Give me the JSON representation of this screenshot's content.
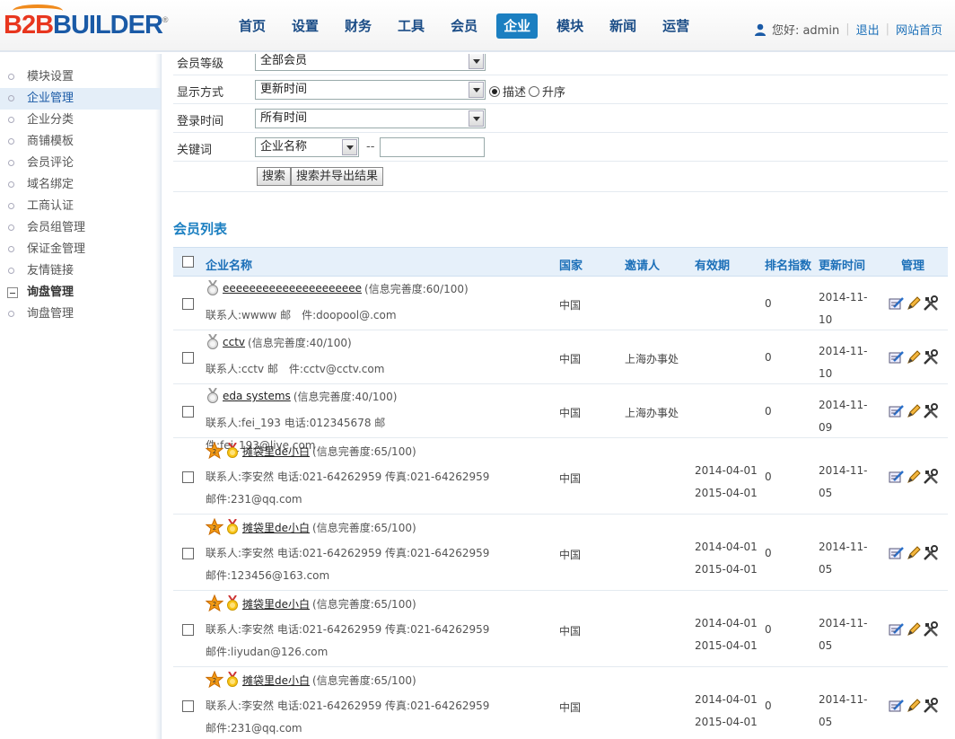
{
  "logo": {
    "b2b": "B2B",
    "builder": "BUILDER",
    "reg": "®"
  },
  "nav": {
    "items": [
      {
        "label": "首页",
        "active": false
      },
      {
        "label": "设置",
        "active": false
      },
      {
        "label": "财务",
        "active": false
      },
      {
        "label": "工具",
        "active": false
      },
      {
        "label": "会员",
        "active": false
      },
      {
        "label": "企业",
        "active": true
      },
      {
        "label": "模块",
        "active": false
      },
      {
        "label": "新闻",
        "active": false
      },
      {
        "label": "运营",
        "active": false
      }
    ]
  },
  "user": {
    "greeting": "您好: admin",
    "logout": "退出",
    "site_home": "网站首页"
  },
  "sidebar": {
    "items": [
      {
        "label": "模块设置"
      },
      {
        "label": "企业管理"
      },
      {
        "label": "企业分类"
      },
      {
        "label": "商铺模板"
      },
      {
        "label": "会员评论"
      },
      {
        "label": "域名绑定"
      },
      {
        "label": "工商认证"
      },
      {
        "label": "会员组管理"
      },
      {
        "label": "保证金管理"
      },
      {
        "label": "友情链接"
      }
    ],
    "group": {
      "label": "询盘管理"
    },
    "group_items": [
      {
        "label": "询盘管理"
      }
    ]
  },
  "filters": {
    "member_level_label": "会员等级",
    "member_level_value": "全部会员",
    "display_label": "显示方式",
    "display_value": "更新时间",
    "order_desc": "描述",
    "order_asc": "升序",
    "login_label": "登录时间",
    "login_value": "所有时间",
    "keyword_label": "关键词",
    "keyword_field": "企业名称",
    "range_sep": "--",
    "search_button": "搜索",
    "export_button": "搜索并导出结果"
  },
  "list": {
    "title": "会员列表",
    "columns": {
      "name": "企业名称",
      "country": "国家",
      "inviter": "邀请人",
      "validity": "有效期",
      "rank": "排名指数",
      "updated": "更新时间",
      "manage": "管理"
    },
    "rows": [
      {
        "name": "eeeeeeeeeeeeeeeeeeeee",
        "completeness": "(信息完善度:60/100)",
        "contact": "联系人:wwww 邮　件:doopool@.com",
        "country": "中国",
        "inviter": "",
        "valid_from": "",
        "valid_to": "",
        "rank": "0",
        "updated": "2014-11-10",
        "vip": false
      },
      {
        "name": "cctv",
        "completeness": "(信息完善度:40/100)",
        "contact": "联系人:cctv 邮　件:cctv@cctv.com",
        "country": "中国",
        "inviter": "上海办事处",
        "valid_from": "",
        "valid_to": "",
        "rank": "0",
        "updated": "2014-11-10",
        "vip": false
      },
      {
        "name": "eda systems",
        "completeness": "(信息完善度:40/100)",
        "contact": "联系人:fei_193 电话:012345678 邮　件:fei_193@live.com",
        "country": "中国",
        "inviter": "上海办事处",
        "valid_from": "",
        "valid_to": "",
        "rank": "0",
        "updated": "2014-11-09",
        "vip": false
      },
      {
        "name": "摊袋里de小白",
        "completeness": "(信息完善度:65/100)",
        "contact": "联系人:李安然 电话:021-64262959 传真:021-64262959 邮件:231@qq.com",
        "country": "中国",
        "inviter": "",
        "valid_from": "2014-04-01",
        "valid_to": "2015-04-01",
        "rank": "0",
        "updated": "2014-11-05",
        "vip": true
      },
      {
        "name": "摊袋里de小白",
        "completeness": "(信息完善度:65/100)",
        "contact": "联系人:李安然 电话:021-64262959 传真:021-64262959 邮件:123456@163.com",
        "country": "中国",
        "inviter": "",
        "valid_from": "2014-04-01",
        "valid_to": "2015-04-01",
        "rank": "0",
        "updated": "2014-11-05",
        "vip": true
      },
      {
        "name": "摊袋里de小白",
        "completeness": "(信息完善度:65/100)",
        "contact": "联系人:李安然 电话:021-64262959 传真:021-64262959 邮件:liyudan@126.com",
        "country": "中国",
        "inviter": "",
        "valid_from": "2014-04-01",
        "valid_to": "2015-04-01",
        "rank": "0",
        "updated": "2014-11-05",
        "vip": true
      },
      {
        "name": "摊袋里de小白",
        "completeness": "(信息完善度:65/100)",
        "contact": "联系人:李安然 电话:021-64262959 传真:021-64262959 邮件:231@qq.com",
        "country": "中国",
        "inviter": "",
        "valid_from": "2014-04-01",
        "valid_to": "2015-04-01",
        "rank": "0",
        "updated": "2014-11-05",
        "vip": true
      }
    ]
  },
  "colors": {
    "accent": "#1b7fc1",
    "nav_text": "#1a4c86",
    "header_bg": "#e6f0fa"
  }
}
